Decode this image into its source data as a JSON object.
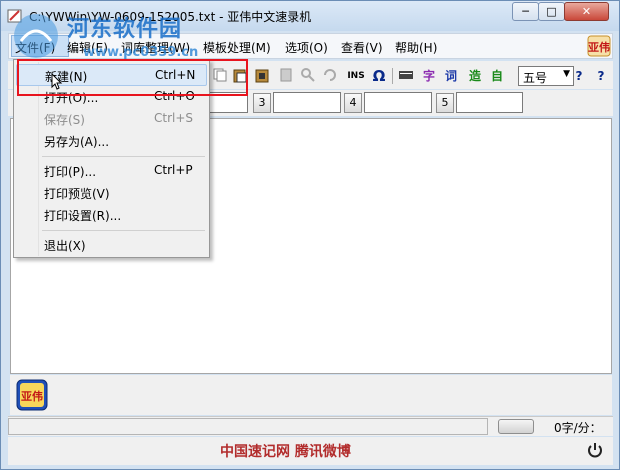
{
  "window": {
    "title": "C:\\YWWin\\YW-0609-152005.txt - 亚伟中文速录机",
    "min_label": "─",
    "max_label": "□",
    "close_label": "✕"
  },
  "watermark": {
    "text": "河东软件园",
    "url": "www.pc0359.cn"
  },
  "menubar": {
    "items": [
      {
        "label": "文件(F)"
      },
      {
        "label": "编辑(E)"
      },
      {
        "label": "词库整理(W)"
      },
      {
        "label": "模板处理(M)"
      },
      {
        "label": "选项(O)"
      },
      {
        "label": "查看(V)"
      },
      {
        "label": "帮助(H)"
      }
    ]
  },
  "toolbar": {
    "ins_label": "INS",
    "omega_label": "Ω",
    "zi_label": "字",
    "ci_label": "词",
    "zao_label": "造",
    "zi2_label": "自",
    "font_size": "五号",
    "help_label": "?",
    "whatsthis_label": "?"
  },
  "fieldbar": {
    "buttons": [
      "3",
      "4",
      "5"
    ]
  },
  "file_menu": {
    "items": [
      {
        "label": "新建(N)",
        "shortcut": "Ctrl+N",
        "enabled": true
      },
      {
        "label": "打开(O)...",
        "shortcut": "Ctrl+O",
        "enabled": true
      },
      {
        "label": "保存(S)",
        "shortcut": "Ctrl+S",
        "enabled": false
      },
      {
        "label": "另存为(A)...",
        "shortcut": "",
        "enabled": true
      },
      {
        "label": "打印(P)...",
        "shortcut": "Ctrl+P",
        "enabled": true
      },
      {
        "label": "打印预览(V)",
        "shortcut": "",
        "enabled": true
      },
      {
        "label": "打印设置(R)...",
        "shortcut": "",
        "enabled": true
      },
      {
        "label": "退出(X)",
        "shortcut": "",
        "enabled": true
      }
    ]
  },
  "status": {
    "speed": "0字/分："
  },
  "footer": {
    "links": "中国速记网  腾讯微博"
  },
  "colors": {
    "highlight": "#e8141e",
    "footer_text": "#b22c2c",
    "watermark": "#1a6fc9"
  }
}
